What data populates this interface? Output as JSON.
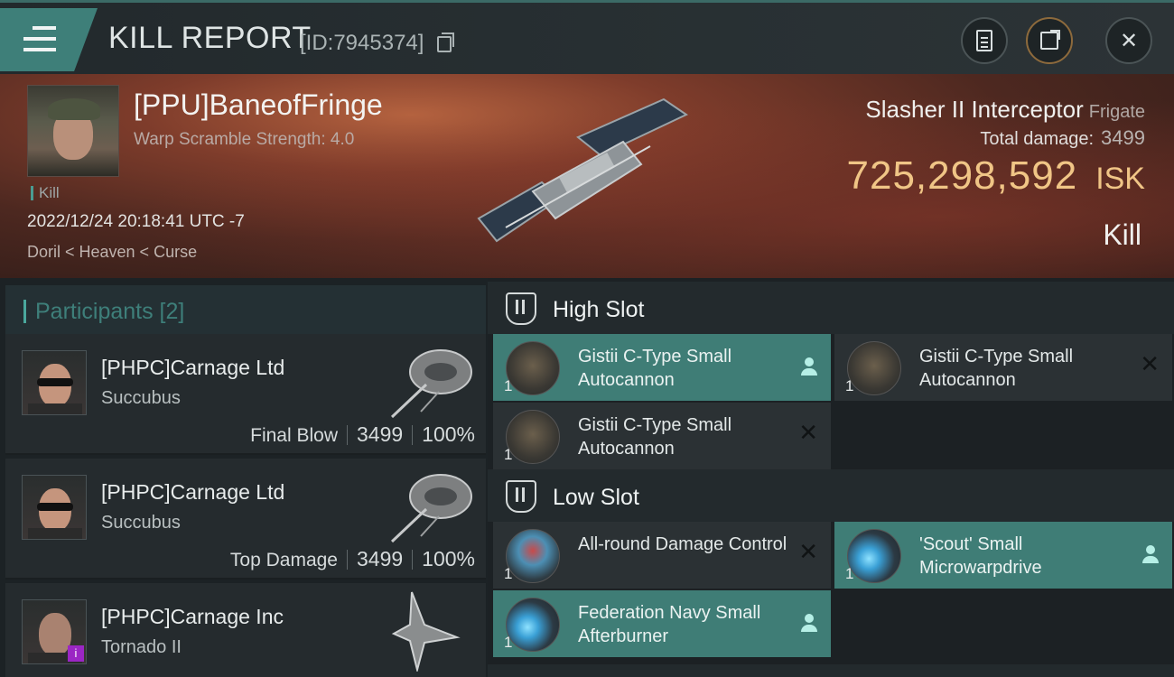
{
  "header": {
    "title": "KILL REPORT",
    "report_id": "[ID:7945374]"
  },
  "victim": {
    "name": "[PPU]BaneofFringe",
    "subtitle": "Warp Scramble Strength: 4.0",
    "tag": "Kill",
    "timestamp": "2022/12/24 20:18:41 UTC -7",
    "location": "Doril < Heaven < Curse",
    "ship_name": "Slasher II Interceptor",
    "ship_class": "Frigate",
    "total_damage_label": "Total damage:",
    "total_damage": "3499",
    "isk_value": "725,298,592",
    "isk_unit": "ISK",
    "result": "Kill"
  },
  "participants": {
    "label": "Participants [2]",
    "rows": [
      {
        "name": "[PHPC]Carnage Ltd",
        "ship": "Succubus",
        "role": "Final Blow",
        "damage": "3499",
        "percent": "100%"
      },
      {
        "name": "[PHPC]Carnage Ltd",
        "ship": "Succubus",
        "role": "Top Damage",
        "damage": "3499",
        "percent": "100%"
      },
      {
        "name": "[PHPC]Carnage Inc",
        "ship": "Tornado II",
        "badge": "i"
      }
    ]
  },
  "fitting": {
    "high_slot": {
      "label": "High Slot",
      "modules": [
        {
          "name": "Gistii C-Type Small Autocannon",
          "qty": "1",
          "status": "fitted",
          "icon": "autocannon-icon"
        },
        {
          "name": "Gistii C-Type Small Autocannon",
          "qty": "1",
          "status": "destroyed",
          "icon": "autocannon-icon"
        },
        {
          "name": "Gistii C-Type Small Autocannon",
          "qty": "1",
          "status": "destroyed",
          "icon": "autocannon-icon"
        }
      ]
    },
    "low_slot": {
      "label": "Low Slot",
      "modules": [
        {
          "name": "All-round Damage Control",
          "qty": "1",
          "status": "destroyed",
          "icon": "damage-control-icon"
        },
        {
          "name": "'Scout' Small Microwarpdrive",
          "qty": "1",
          "status": "fitted",
          "icon": "microwarpdrive-icon"
        },
        {
          "name": "Federation Navy Small Afterburner",
          "qty": "1",
          "status": "fitted",
          "icon": "afterburner-icon"
        }
      ]
    }
  },
  "colors": {
    "accent_teal": "#3f7d76",
    "isk_gold": "#f0c586",
    "header_bg": "#283033"
  }
}
